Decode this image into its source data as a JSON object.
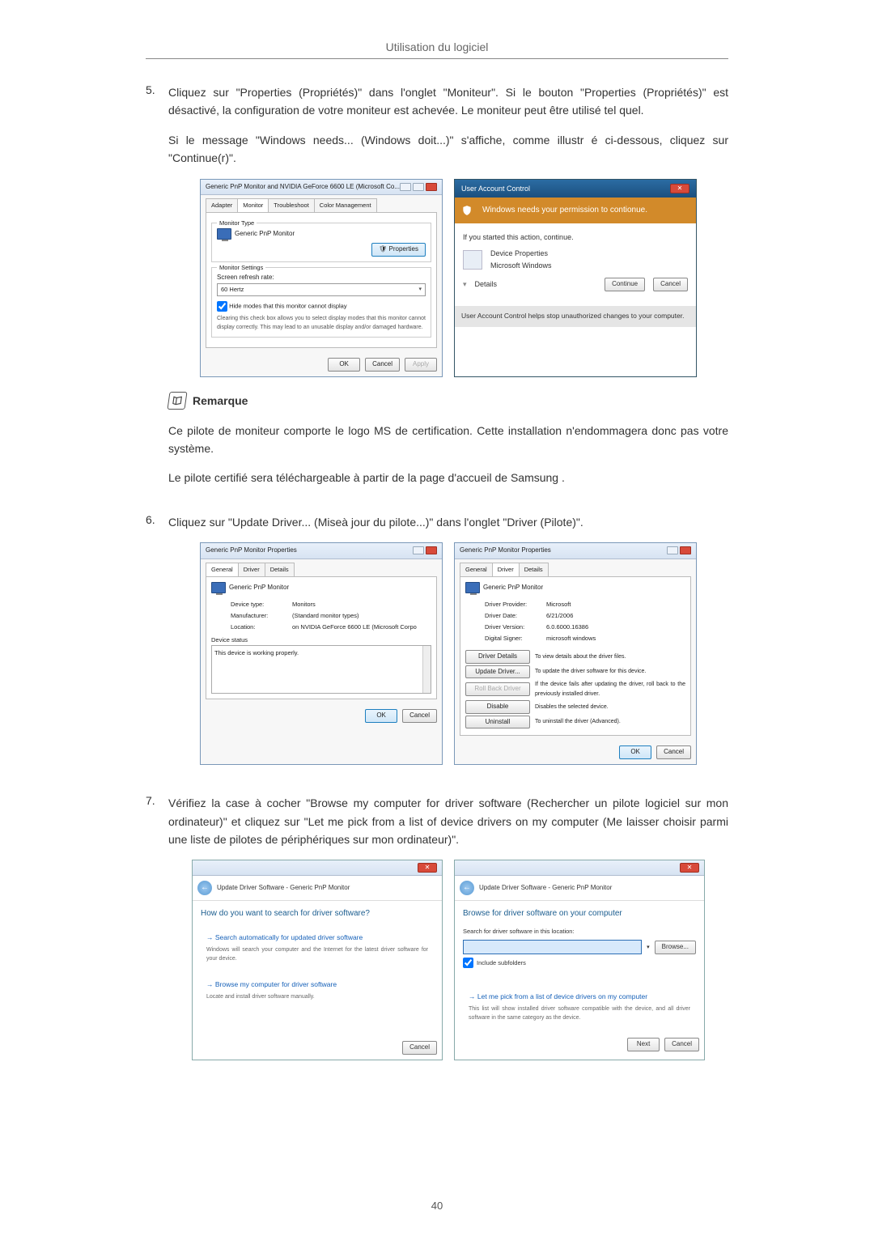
{
  "header": {
    "title": "Utilisation du logiciel"
  },
  "page_number": "40",
  "step5": {
    "num": "5.",
    "p1": "Cliquez sur \"Properties (Propriétés)\" dans l'onglet \"Moniteur\". Si le bouton \"Properties (Propriétés)\" est désactivé, la configuration de votre moniteur est achevée. Le moniteur peut être utilisé tel quel.",
    "p2": "Si le message \"Windows needs... (Windows doit...)\" s'affiche, comme illustr é ci-dessous, cliquez sur \"Continue(r)\"."
  },
  "fig1": {
    "win_title": "Generic PnP Monitor and NVIDIA GeForce 6600 LE (Microsoft Co...",
    "tabs": [
      "Adapter",
      "Monitor",
      "Troubleshoot",
      "Color Management"
    ],
    "group1": "Monitor Type",
    "monitor_name": "Generic PnP Monitor",
    "prop_btn": "Properties",
    "group2": "Monitor Settings",
    "refresh_lbl": "Screen refresh rate:",
    "refresh_val": "60 Hertz",
    "hide_chk": "Hide modes that this monitor cannot display",
    "hide_desc": "Clearing this check box allows you to select display modes that this monitor cannot display correctly. This may lead to an unusable display and/or damaged hardware.",
    "ok": "OK",
    "cancel": "Cancel",
    "apply": "Apply"
  },
  "uac": {
    "title": "User Account Control",
    "banner": "Windows needs your permission to contionue.",
    "line1": "If you started this action, continue.",
    "prog_name": "Device Properties",
    "prog_pub": "Microsoft Windows",
    "details": "Details",
    "continue": "Continue",
    "cancel": "Cancel",
    "foot": "User Account Control helps stop unauthorized changes to your computer."
  },
  "remark": {
    "label": "Remarque",
    "p1": "Ce pilote de moniteur comporte le logo MS de certification. Cette installation n'endommagera donc pas votre système.",
    "p2": "Le pilote certifié sera téléchargeable à partir de la page d'accueil de Samsung ."
  },
  "step6": {
    "num": "6.",
    "p1": "Cliquez sur \"Update Driver... (Miseà jour du pilote...)\" dans l'onglet \"Driver (Pilote)\"."
  },
  "fig2a": {
    "win_title": "Generic PnP Monitor Properties",
    "tabs": [
      "General",
      "Driver",
      "Details"
    ],
    "monitor_name": "Generic PnP Monitor",
    "rows": {
      "devtype_k": "Device type:",
      "devtype_v": "Monitors",
      "manu_k": "Manufacturer:",
      "manu_v": "(Standard monitor types)",
      "loc_k": "Location:",
      "loc_v": "on NVIDIA GeForce 6600 LE (Microsoft Corpo"
    },
    "status_lbl": "Device status",
    "status_txt": "This device is working properly.",
    "ok": "OK",
    "cancel": "Cancel"
  },
  "fig2b": {
    "win_title": "Generic PnP Monitor Properties",
    "tabs": [
      "General",
      "Driver",
      "Details"
    ],
    "monitor_name": "Generic PnP Monitor",
    "rows": {
      "prov_k": "Driver Provider:",
      "prov_v": "Microsoft",
      "date_k": "Driver Date:",
      "date_v": "6/21/2006",
      "ver_k": "Driver Version:",
      "ver_v": "6.0.6000.16386",
      "sign_k": "Digital Signer:",
      "sign_v": "microsoft windows"
    },
    "btns": {
      "details": "Driver Details",
      "details_d": "To view details about the driver files.",
      "update": "Update Driver...",
      "update_d": "To update the driver software for this device.",
      "rollback": "Roll Back Driver",
      "rollback_d": "If the device fails after updating the driver, roll back to the previously installed driver.",
      "disable": "Disable",
      "disable_d": "Disables the selected device.",
      "uninstall": "Uninstall",
      "uninstall_d": "To uninstall the driver (Advanced)."
    },
    "ok": "OK",
    "cancel": "Cancel"
  },
  "step7": {
    "num": "7.",
    "p1": "Vérifiez la case à cocher \"Browse my computer for driver software (Rechercher un pilote logiciel sur mon ordinateur)\" et cliquez sur \"Let me pick from a list of device drivers on my computer (Me laisser choisir parmi une liste de pilotes de périphériques sur mon ordinateur)\"."
  },
  "wiz1": {
    "crumb": "Update Driver Software - Generic PnP Monitor",
    "heading": "How do you want to search for driver software?",
    "opt1_t": "Search automatically for updated driver software",
    "opt1_d": "Windows will search your computer and the Internet for the latest driver software for your device.",
    "opt2_t": "Browse my computer for driver software",
    "opt2_d": "Locate and install driver software manually.",
    "cancel": "Cancel"
  },
  "wiz2": {
    "crumb": "Update Driver Software - Generic PnP Monitor",
    "heading": "Browse for driver software on your computer",
    "loc_lbl": "Search for driver software in this location:",
    "browse": "Browse...",
    "include": "Include subfolders",
    "opt_t": "Let me pick from a list of device drivers on my computer",
    "opt_d": "This list will show installed driver software compatible with the device, and all driver software in the same category as the device.",
    "next": "Next",
    "cancel": "Cancel"
  }
}
